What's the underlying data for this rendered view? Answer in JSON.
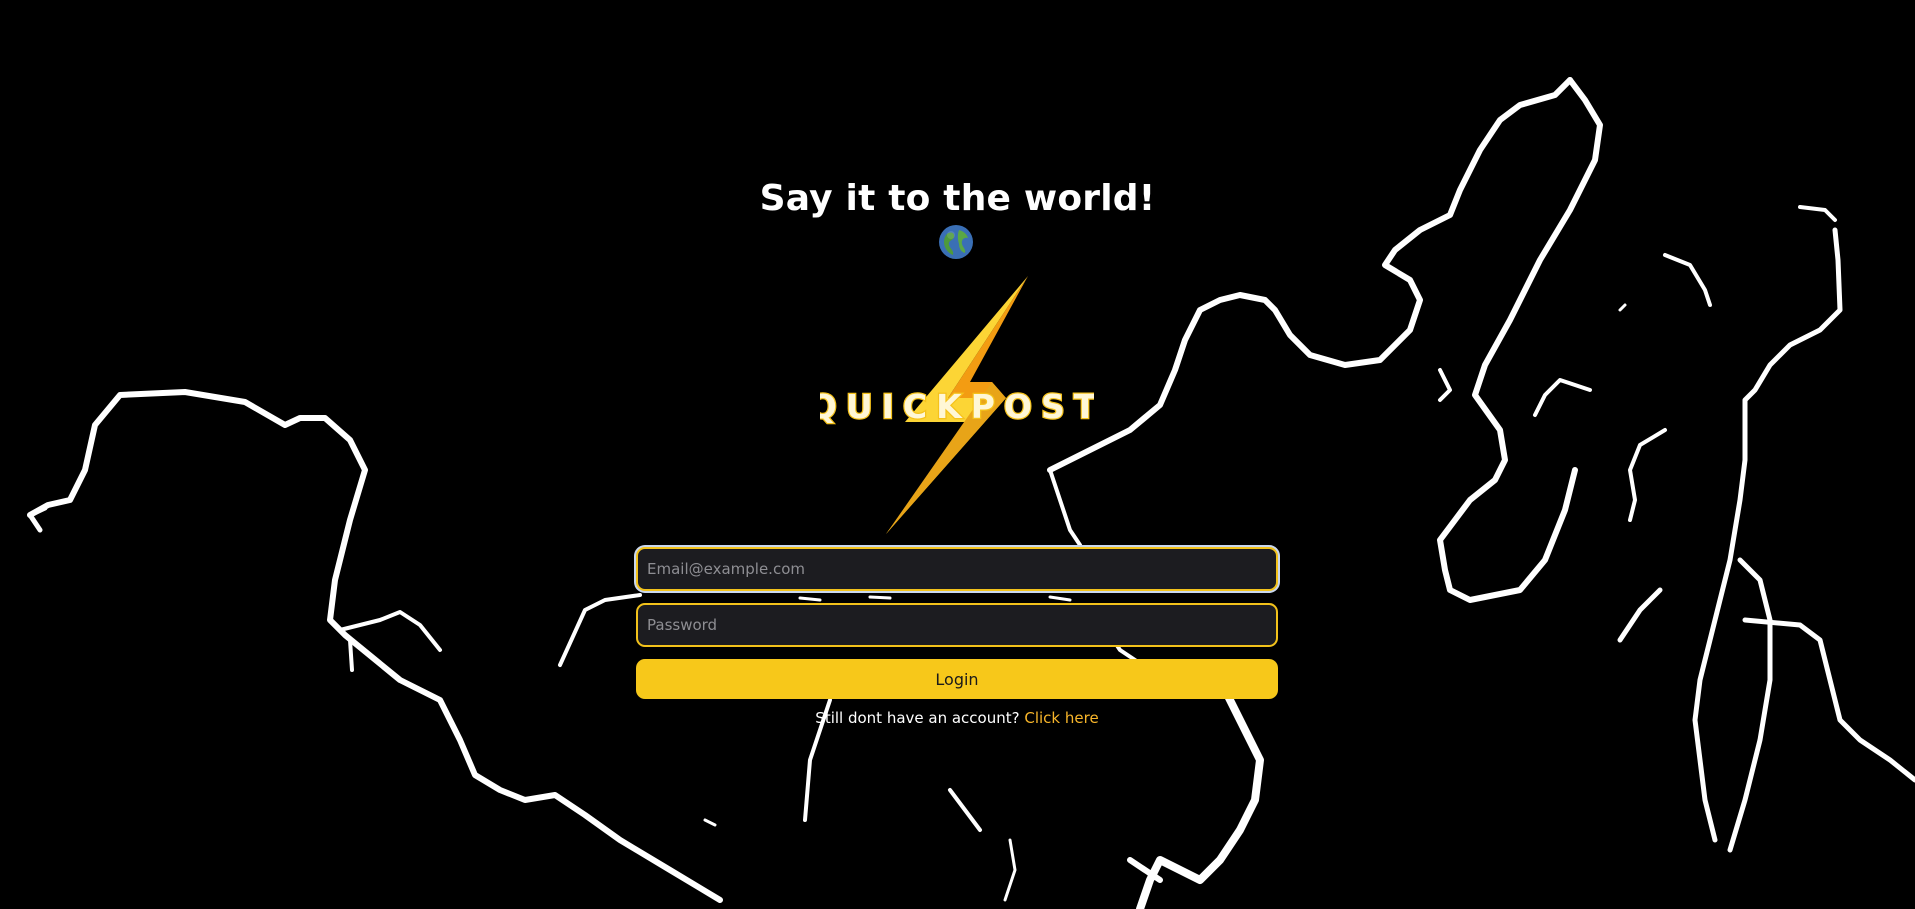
{
  "hero": {
    "headline": "Say it to the world!",
    "globe_icon": "globe-icon"
  },
  "logo": {
    "text": "QUICKPOST",
    "icon": "lightning-bolt-icon",
    "colors": {
      "bolt_light": "#fcd535",
      "bolt_dark": "#f39c12",
      "text_fill": "#fff7d6",
      "text_outline": "#f5c21b"
    }
  },
  "login_form": {
    "email_placeholder": "Email@example.com",
    "email_value": "",
    "password_placeholder": "Password",
    "password_value": "",
    "submit_label": "Login",
    "signup_prompt": "Still dont have an account?",
    "signup_link": "Click here"
  },
  "theme": {
    "background": "#000000",
    "accent": "#f7c81a",
    "link": "#f7b52a",
    "input_bg": "#1c1c20"
  }
}
